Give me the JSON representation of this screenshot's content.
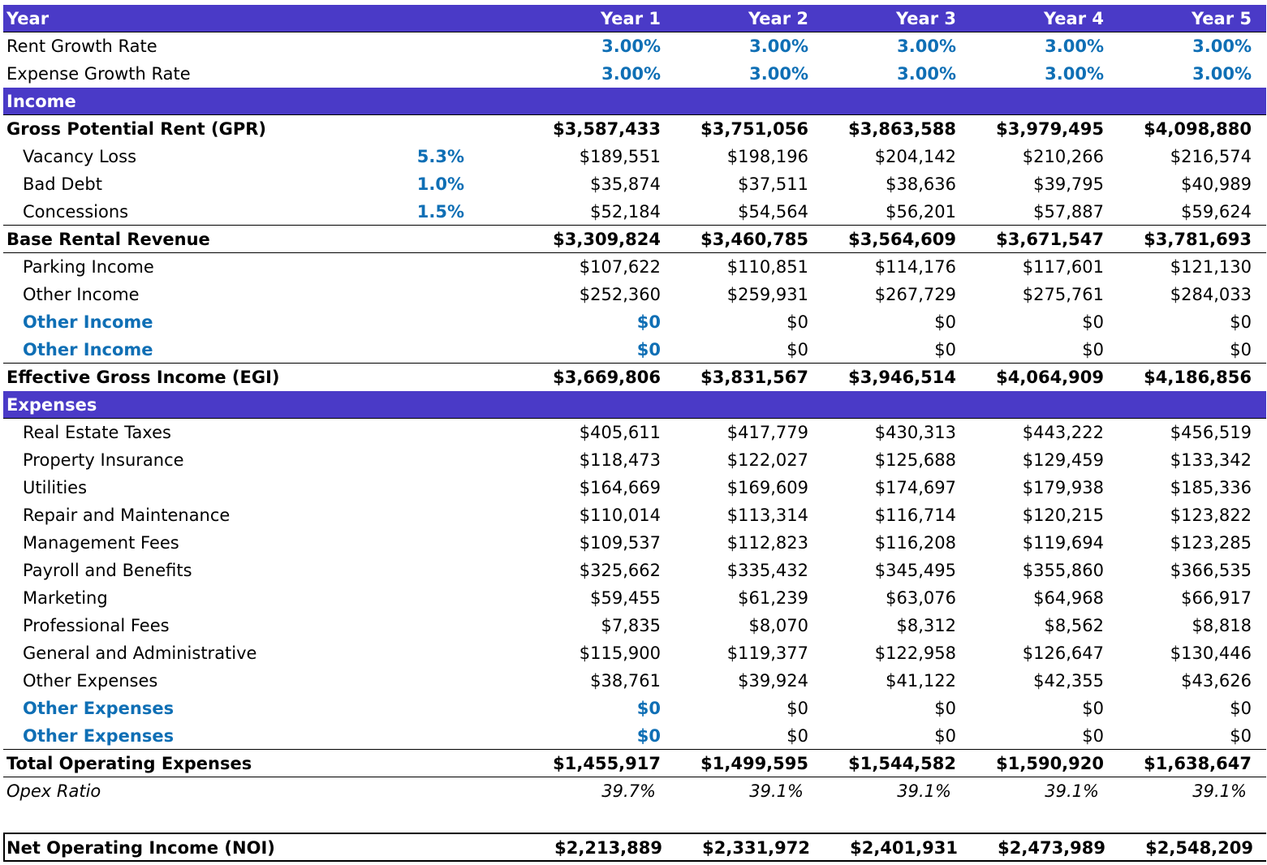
{
  "header": {
    "label": "Year",
    "years": [
      "Year 1",
      "Year 2",
      "Year 3",
      "Year 4",
      "Year 5"
    ]
  },
  "growth": [
    {
      "label": "Rent Growth Rate",
      "values": [
        "3.00%",
        "3.00%",
        "3.00%",
        "3.00%",
        "3.00%"
      ]
    },
    {
      "label": "Expense Growth Rate",
      "values": [
        "3.00%",
        "3.00%",
        "3.00%",
        "3.00%",
        "3.00%"
      ]
    }
  ],
  "income_header": "Income",
  "gpr": {
    "label": "Gross Potential Rent (GPR)",
    "values": [
      "$3,587,433",
      "$3,751,056",
      "$3,863,588",
      "$3,979,495",
      "$4,098,880"
    ]
  },
  "deductions": [
    {
      "label": "Vacancy Loss",
      "pct": "5.3%",
      "values": [
        "$189,551",
        "$198,196",
        "$204,142",
        "$210,266",
        "$216,574"
      ]
    },
    {
      "label": "Bad Debt",
      "pct": "1.0%",
      "values": [
        "$35,874",
        "$37,511",
        "$38,636",
        "$39,795",
        "$40,989"
      ]
    },
    {
      "label": "Concessions",
      "pct": "1.5%",
      "values": [
        "$52,184",
        "$54,564",
        "$56,201",
        "$57,887",
        "$59,624"
      ]
    }
  ],
  "base_rental": {
    "label": "Base Rental Revenue",
    "values": [
      "$3,309,824",
      "$3,460,785",
      "$3,564,609",
      "$3,671,547",
      "$3,781,693"
    ]
  },
  "other_income": [
    {
      "label": "Parking Income",
      "values": [
        "$107,622",
        "$110,851",
        "$114,176",
        "$117,601",
        "$121,130"
      ]
    },
    {
      "label": "Other Income",
      "values": [
        "$252,360",
        "$259,931",
        "$267,729",
        "$275,761",
        "$284,033"
      ]
    },
    {
      "label": "Other Income",
      "values": [
        "$0",
        "$0",
        "$0",
        "$0",
        "$0"
      ]
    },
    {
      "label": "Other Income",
      "values": [
        "$0",
        "$0",
        "$0",
        "$0",
        "$0"
      ]
    }
  ],
  "egi": {
    "label": "Effective Gross Income (EGI)",
    "values": [
      "$3,669,806",
      "$3,831,567",
      "$3,946,514",
      "$4,064,909",
      "$4,186,856"
    ]
  },
  "expenses_header": "Expenses",
  "expenses": [
    {
      "label": "Real Estate Taxes",
      "values": [
        "$405,611",
        "$417,779",
        "$430,313",
        "$443,222",
        "$456,519"
      ]
    },
    {
      "label": "Property Insurance",
      "values": [
        "$118,473",
        "$122,027",
        "$125,688",
        "$129,459",
        "$133,342"
      ]
    },
    {
      "label": "Utilities",
      "values": [
        "$164,669",
        "$169,609",
        "$174,697",
        "$179,938",
        "$185,336"
      ]
    },
    {
      "label": "Repair and Maintenance",
      "values": [
        "$110,014",
        "$113,314",
        "$116,714",
        "$120,215",
        "$123,822"
      ]
    },
    {
      "label": "Management Fees",
      "values": [
        "$109,537",
        "$112,823",
        "$116,208",
        "$119,694",
        "$123,285"
      ]
    },
    {
      "label": "Payroll and Benefits",
      "values": [
        "$325,662",
        "$335,432",
        "$345,495",
        "$355,860",
        "$366,535"
      ]
    },
    {
      "label": "Marketing",
      "values": [
        "$59,455",
        "$61,239",
        "$63,076",
        "$64,968",
        "$66,917"
      ]
    },
    {
      "label": "Professional Fees",
      "values": [
        "$7,835",
        "$8,070",
        "$8,312",
        "$8,562",
        "$8,818"
      ]
    },
    {
      "label": "General and Administrative",
      "values": [
        "$115,900",
        "$119,377",
        "$122,958",
        "$126,647",
        "$130,446"
      ]
    },
    {
      "label": "Other Expenses",
      "values": [
        "$38,761",
        "$39,924",
        "$41,122",
        "$42,355",
        "$43,626"
      ]
    },
    {
      "label": "Other Expenses",
      "values": [
        "$0",
        "$0",
        "$0",
        "$0",
        "$0"
      ]
    },
    {
      "label": "Other Expenses",
      "values": [
        "$0",
        "$0",
        "$0",
        "$0",
        "$0"
      ]
    }
  ],
  "total_opex": {
    "label": "Total Operating Expenses",
    "values": [
      "$1,455,917",
      "$1,499,595",
      "$1,544,582",
      "$1,590,920",
      "$1,638,647"
    ]
  },
  "opex_ratio": {
    "label": "Opex Ratio",
    "values": [
      "39.7%",
      "39.1%",
      "39.1%",
      "39.1%",
      "39.1%"
    ]
  },
  "noi": {
    "label": "Net Operating Income (NOI)",
    "values": [
      "$2,213,889",
      "$2,331,972",
      "$2,401,931",
      "$2,473,989",
      "$2,548,209"
    ]
  },
  "colors": {
    "header_bg": "#4a3ac7",
    "input_blue": "#0f6fb5"
  }
}
